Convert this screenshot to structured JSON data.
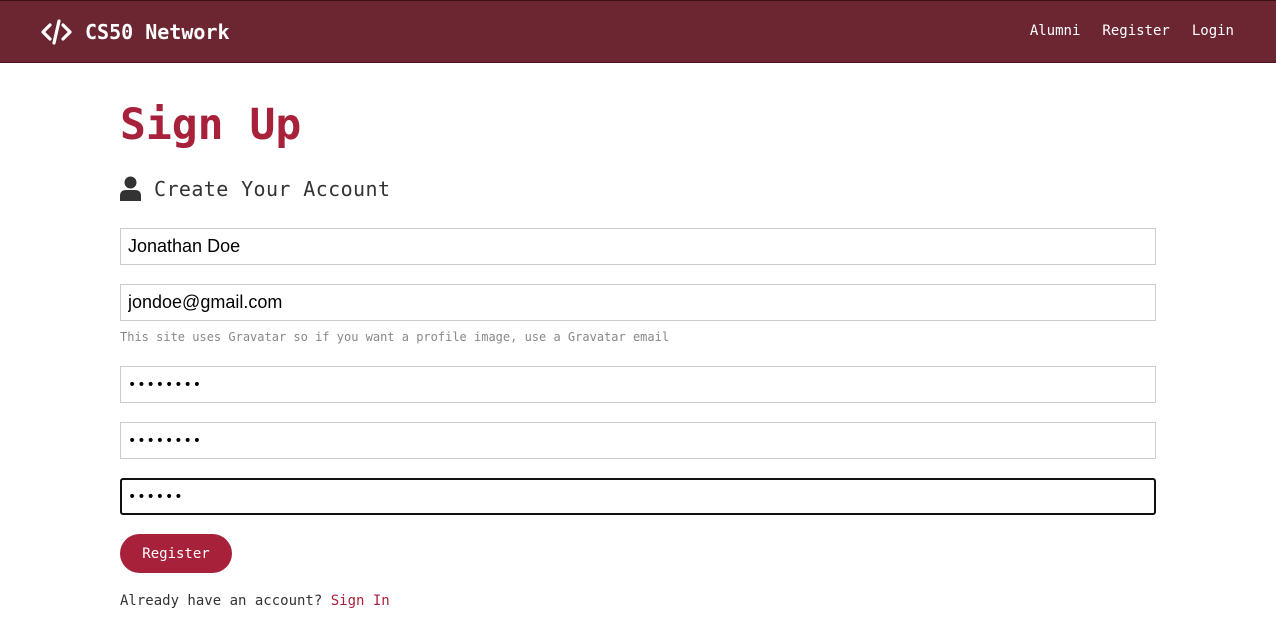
{
  "nav": {
    "brand_icon": "code-icon",
    "brand": "CS50 Network",
    "links": [
      "Alumni",
      "Register",
      "Login"
    ]
  },
  "main": {
    "title": "Sign Up",
    "lead_icon": "user-icon",
    "lead": "Create Your Account",
    "fields": {
      "name_value": "Jonathan Doe",
      "email_value": "jondoe@gmail.com",
      "email_help": "This site uses Gravatar so if you want a profile image, use a Gravatar email",
      "password_value": "••••••••",
      "password2_value": "••••••••",
      "password3_value": "••••••"
    },
    "register_button": "Register",
    "signin_prompt": "Already have an account?",
    "signin_link": "Sign In"
  },
  "colors": {
    "navbar": "#6b2632",
    "accent": "#a8213b"
  }
}
